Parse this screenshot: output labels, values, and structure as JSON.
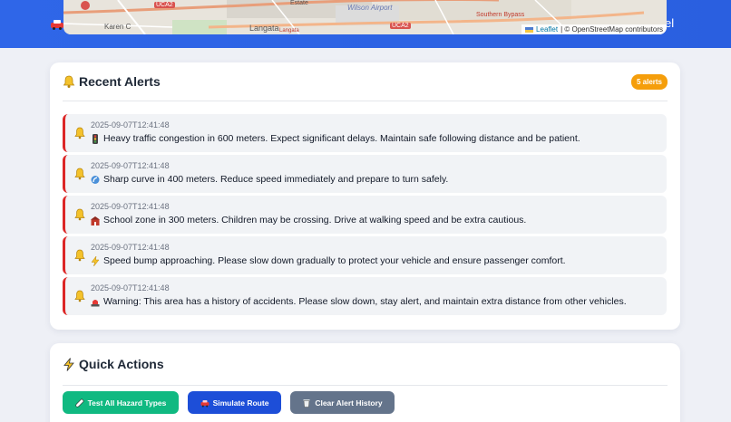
{
  "map": {
    "labels": [
      "Karen C",
      "Langata",
      "Wilson Airport",
      "Estate",
      "UCA2",
      "UCA2",
      "Langata",
      "Southern Bypass"
    ],
    "attribution_link": "Leaflet",
    "attribution_text": "| © OpenStreetMap contributors"
  },
  "banner": {
    "partial_text": "el"
  },
  "alerts": {
    "title": "Recent Alerts",
    "count_badge": "5 alerts",
    "items": [
      {
        "timestamp": "2025-09-07T12:41:48",
        "icon": "traffic-light-icon",
        "message": "Heavy traffic congestion in 600 meters. Expect significant delays. Maintain safe following distance and be patient."
      },
      {
        "timestamp": "2025-09-07T12:41:48",
        "icon": "curve-icon",
        "message": "Sharp curve in 400 meters. Reduce speed immediately and prepare to turn safely."
      },
      {
        "timestamp": "2025-09-07T12:41:48",
        "icon": "school-icon",
        "message": "School zone in 300 meters. Children may be crossing. Drive at walking speed and be extra cautious."
      },
      {
        "timestamp": "2025-09-07T12:41:48",
        "icon": "lightning-icon",
        "message": "Speed bump approaching. Please slow down gradually to protect your vehicle and ensure passenger comfort."
      },
      {
        "timestamp": "2025-09-07T12:41:48",
        "icon": "siren-icon",
        "message": "Warning: This area has a history of accidents. Please slow down, stay alert, and maintain extra distance from other vehicles."
      }
    ]
  },
  "actions": {
    "title": "Quick Actions",
    "buttons": {
      "test_all": "Test All Hazard Types",
      "simulate": "Simulate Route",
      "clear": "Clear Alert History"
    }
  },
  "colors": {
    "banner": "#2f66e8",
    "alert_border": "#dc2626",
    "badge": "#f59e0b",
    "test_button": "#10b981",
    "simulate_button": "#1d4ed8",
    "clear_button": "#64748b"
  }
}
